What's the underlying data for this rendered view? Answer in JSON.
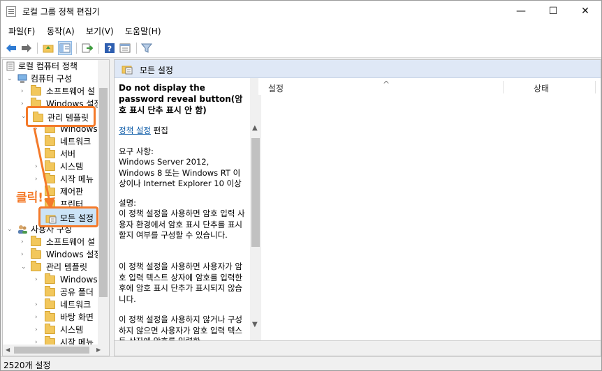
{
  "window": {
    "title": "로컬 그룹 정책 편집기",
    "minimize_glyph": "—",
    "maximize_glyph": "☐",
    "close_glyph": "✕"
  },
  "menu": [
    "파일(F)",
    "동작(A)",
    "보기(V)",
    "도움말(H)"
  ],
  "toolbar": {
    "icons": [
      "back-arrow-icon",
      "forward-arrow-icon",
      "up-folder-icon",
      "show-hide-tree-icon",
      "export-list-icon",
      "help-icon",
      "properties-icon",
      "filter-icon"
    ]
  },
  "tree": {
    "root": "로컬 컴퓨터 정책",
    "computer_config": "컴퓨터 구성",
    "cc_software": "소프트웨어 설",
    "cc_windows": "Windows 설정",
    "cc_admin_templates": "관리 템플릿",
    "at_windows": "Windows",
    "at_network": "네트워크",
    "at_server": "서버",
    "at_system": "시스템",
    "at_start_menu": "시작 메뉴",
    "at_control_panel": "제어판",
    "at_printers": "프린터",
    "at_all_settings": "모든 설정",
    "user_config": "사용자 구성",
    "uc_software": "소프트웨어 설",
    "uc_windows": "Windows 설정",
    "uc_admin_templates": "관리 템플릿",
    "uat_windows": "Windows",
    "uat_shared_folders": "공유 폴더",
    "uat_network": "네트워크",
    "uat_desktop": "바탕 화면",
    "uat_system": "시스템",
    "uat_start_menu": "시작 메뉴"
  },
  "annotation": {
    "click_label": "클릭!",
    "color": "#f47a2a"
  },
  "content": {
    "header_title": "모든 설정",
    "policy_title": "Do not display the password reveal button(암호 표시 단추 표시 안 함)",
    "edit_link": "정책 설정",
    "edit_suffix": "편집",
    "requirements_label": "요구 사항:",
    "requirements_text": "Windows Server 2012, Windows 8 또는 Windows RT 이상이나 Internet Explorer 10 이상",
    "description_label": "설명:",
    "description_p1": "이 정책 설정을 사용하면 암호 입력 사용자 환경에서 암호 표시 단추를 표시할지 여부를 구성할 수 있습니다.",
    "description_p2": "이 정책 설정을 사용하면 사용자가 암호 입력 텍스트 상자에 암호를 입력한 후에 암호 표시 단추가 표시되지 않습니다.",
    "description_p3": "이 정책 설정을 사용하지 않거나 구성하지 않으면 사용자가 암호 입력 텍스트 상자에 암호를 입력한",
    "col_setting": "설정",
    "col_status": "상태",
    "sort_glyph": "^"
  },
  "status": {
    "text": "2520개 설정"
  }
}
